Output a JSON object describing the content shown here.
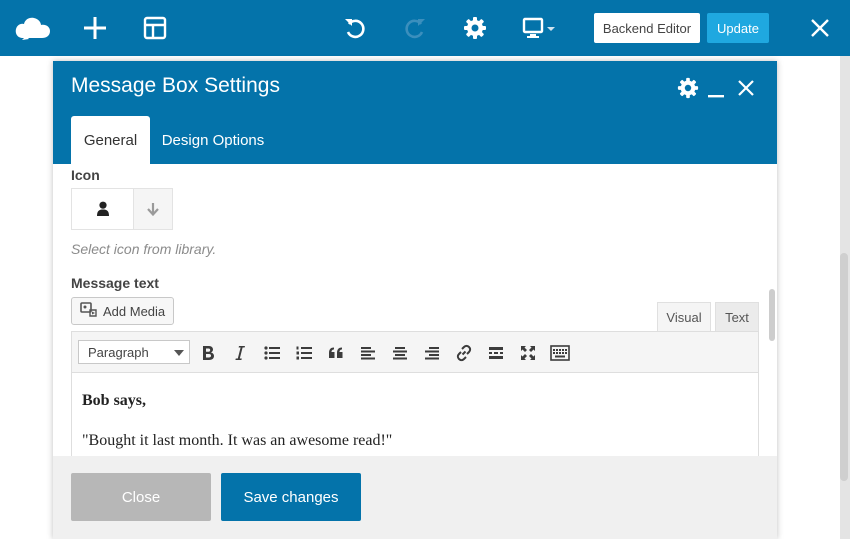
{
  "toolbar": {
    "icons": [
      "cloud-logo-icon",
      "plus-icon",
      "layout-icon",
      "undo-icon",
      "redo-icon",
      "gear-icon",
      "monitor-icon",
      "close-icon"
    ],
    "backend_editor_label": "Backend Editor",
    "update_label": "Update"
  },
  "modal": {
    "title": "Message Box Settings",
    "tabs": [
      {
        "label": "General",
        "active": true
      },
      {
        "label": "Design Options",
        "active": false
      }
    ],
    "icon_field": {
      "label": "Icon",
      "hint": "Select icon from library."
    },
    "message_field": {
      "label": "Message text",
      "add_media_label": "Add Media",
      "editor_tabs": [
        "Visual",
        "Text"
      ],
      "format_selected": "Paragraph",
      "content": [
        "Bob says,",
        "\"Bought it last month. It was an awesome read!\""
      ]
    },
    "footer": {
      "close_label": "Close",
      "save_label": "Save changes"
    }
  },
  "colors": {
    "brand": "#0473aa",
    "update": "#1fa8e0",
    "close_button": "#b7b7b7"
  }
}
